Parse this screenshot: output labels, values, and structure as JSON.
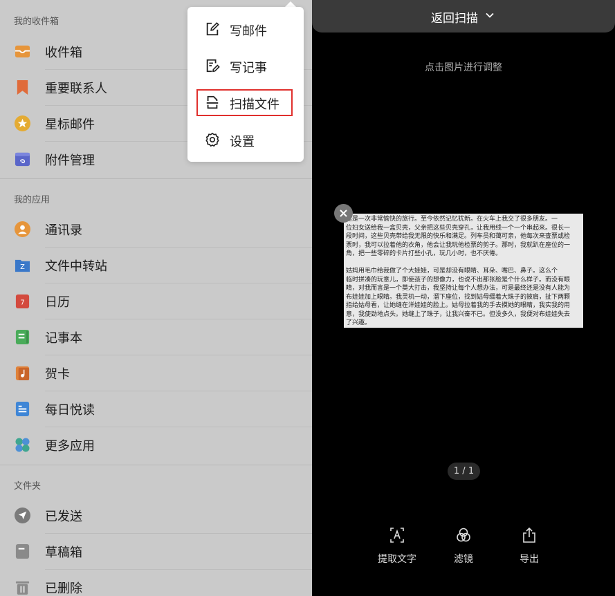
{
  "left_panel": {
    "sections": [
      {
        "title": "我的收件箱",
        "items": [
          {
            "label": "收件箱",
            "icon": "inbox-icon",
            "color": "#e6953b"
          },
          {
            "label": "重要联系人",
            "icon": "bookmark-icon",
            "color": "#e06b3a"
          },
          {
            "label": "星标邮件",
            "icon": "star-icon",
            "color": "#e4ab33"
          },
          {
            "label": "附件管理",
            "icon": "attachment-icon",
            "color": "#5a66c9"
          }
        ]
      },
      {
        "title": "我的应用",
        "items": [
          {
            "label": "通讯录",
            "icon": "contacts-icon",
            "color": "#e6953b"
          },
          {
            "label": "文件中转站",
            "icon": "folder-transfer-icon",
            "color": "#3a78c9"
          },
          {
            "label": "日历",
            "icon": "calendar-icon",
            "color": "#d34a3e"
          },
          {
            "label": "记事本",
            "icon": "notepad-icon",
            "color": "#4aab5a"
          },
          {
            "label": "贺卡",
            "icon": "greeting-card-icon",
            "color": "#e0823a"
          },
          {
            "label": "每日悦读",
            "icon": "daily-reading-icon",
            "color": "#3f86d6"
          },
          {
            "label": "更多应用",
            "icon": "more-apps-icon",
            "color": "#3fa690"
          }
        ]
      },
      {
        "title": "文件夹",
        "items": [
          {
            "label": "已发送",
            "icon": "sent-icon",
            "color": "#7a7a7a"
          },
          {
            "label": "草稿箱",
            "icon": "drafts-icon",
            "color": "#8a8a8a"
          },
          {
            "label": "已删除",
            "icon": "trash-icon",
            "color": "#8a8a8a"
          }
        ]
      }
    ],
    "calendar_day": "7",
    "folder_badge": "Z"
  },
  "popup_menu": {
    "items": [
      {
        "label": "写邮件",
        "icon": "compose-mail-icon"
      },
      {
        "label": "写记事",
        "icon": "write-note-icon"
      },
      {
        "label": "扫描文件",
        "icon": "scan-document-icon",
        "highlighted": true
      },
      {
        "label": "设置",
        "icon": "gear-icon"
      }
    ],
    "highlight_color": "#e0302d"
  },
  "scan_view": {
    "header_title": "返回扫描",
    "hint": "点击图片进行调整",
    "page_indicator": "1 / 1",
    "document_lines": [
      "    这是一次非常愉快的旅行。至今依然记忆犹新。在火车上我交了很多朋友。一",
      "位妇女送给我一盒贝壳，父亲把这些贝壳穿孔，让我用线一个一个串起来。很长一",
      "段时间，这些贝壳带给我无限的快乐和满足。列车员和蔼可亲，他每次来查票或检",
      "票时，我可以拉着他的衣角，他会让我玩他检票的剪子。那时，我就趴在座位的一",
      "角，把一些零碎的卡片打些小孔，玩几小时，也不厌倦。",
      "",
      "    姑妈用毛巾给我做了个大娃娃，可是却没有眼睛、耳朵、嘴巴、鼻子。这么个",
      "临时拼凑的玩意儿，即使孩子的想像力，也说不出那张脸是个什么样子。而没有眼",
      "睛，对我而言是一个莫大打击，我坚持让每个人想办法，可是最终还是没有人能为",
      "布娃娃加上眼睛。我灵机一动，溜下座位，找到姑母缀着大珠子的披肩，扯下两颗",
      "指给姑母看，让她缝在洋娃娃的脸上。姑母拉着我的手去摸她的眼睛，我实我的用",
      "意，我使劲地点头。她缝上了珠子，让我兴奋不已。但没多久，我便对布娃娃失去",
      "了兴趣。"
    ],
    "toolbar": [
      {
        "label": "提取文字",
        "icon": "text-recognition-icon"
      },
      {
        "label": "滤镜",
        "icon": "filter-icon"
      },
      {
        "label": "导出",
        "icon": "export-icon"
      }
    ],
    "colors": {
      "topbar": "#3a3a3a",
      "background": "#000000",
      "text": "#dddddd"
    }
  }
}
